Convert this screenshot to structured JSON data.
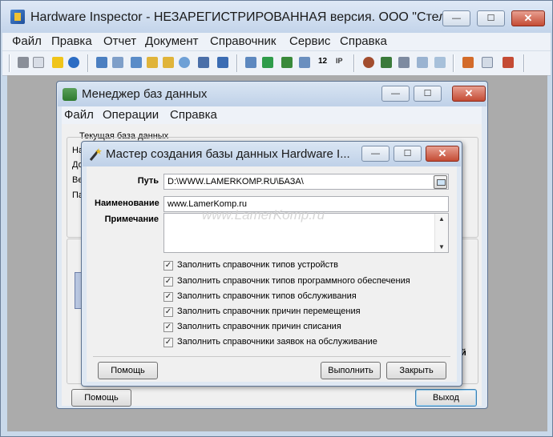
{
  "main_window": {
    "title": "Hardware Inspector - НЕЗАРЕГИСТРИРОВАННАЯ версия. ООО \"Стелла\"",
    "menu": [
      "Файл",
      "Правка",
      "Отчет",
      "Документ",
      "Справочник",
      "Сервис",
      "Справка"
    ]
  },
  "db_manager": {
    "title": "Менеджер баз данных",
    "menu": [
      "Файл",
      "Операции",
      "Справка"
    ],
    "current_db_group": "Текущая база данных",
    "field_stubs": [
      "На",
      "До",
      "Ве",
      "Па"
    ],
    "help_button": "Помощь",
    "exit_button": "Выход",
    "edge_letter": "й"
  },
  "wizard": {
    "title": "Мастер создания базы данных Hardware I...",
    "path_label": "Путь",
    "path_value": "D:\\WWW.LAMERKOMP.RU\\БАЗА\\",
    "name_label": "Наименование",
    "name_value": "www.LamerKomp.ru",
    "note_label": "Примечание",
    "note_value": "",
    "checkboxes": [
      {
        "label": "Заполнить справочник типов устройств",
        "checked": true
      },
      {
        "label": "Заполнить справочник типов программного обеспечения",
        "checked": true
      },
      {
        "label": "Заполнить справочник типов обслуживания",
        "checked": true
      },
      {
        "label": "Заполнить справочник причин перемещения",
        "checked": true
      },
      {
        "label": "Заполнить справочник причин списания",
        "checked": true
      },
      {
        "label": "Заполнить справочники заявок на обслуживание",
        "checked": true
      }
    ],
    "help_button": "Помощь",
    "run_button": "Выполнить",
    "close_button": "Закрыть"
  },
  "watermark": "www.LamerKomp.ru",
  "window_buttons": {
    "minimize": "—",
    "maximize": "☐",
    "close": "✕"
  },
  "toolbar_icons": [
    "print-preview",
    "document",
    "help",
    "info",
    "network",
    "computers",
    "search-pc",
    "search-pc-2",
    "search-pc-3",
    "find",
    "monitor",
    "users",
    "pc-list",
    "chart",
    "network-card",
    "ip-counter",
    "ip",
    "user",
    "user-edit",
    "tools",
    "exchange",
    "report",
    "report-2",
    "settings"
  ],
  "toolbar_ip_text": "12",
  "toolbar_ip_suffix": "IP"
}
